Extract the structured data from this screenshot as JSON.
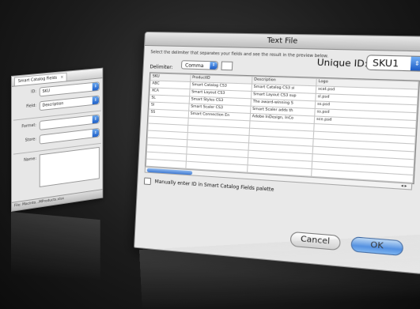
{
  "palette": {
    "tab_label": "Smart Catalog Fields",
    "close_glyph": "×",
    "id_label": "ID:",
    "id_value": "SKU",
    "field_label": "Field:",
    "field_value": "Description",
    "format_label": "Format:",
    "store_label": "Store:",
    "name_label": "Name:",
    "status_text": "File: Macinto...MProducts.xlsx",
    "arrows_glyph": "⇕"
  },
  "dialog": {
    "title": "Text File",
    "instructions": "Select the delimiter that separates your fields and see the result in the preview below.",
    "unique_id_label": "Unique ID:",
    "unique_id_value": "SKU1",
    "delimiter_label": "Delimiter:",
    "delimiter_value": "Comma",
    "arrows_glyph": "⇕",
    "columns": [
      "SKU",
      "ProductID",
      "Description",
      "Logo"
    ],
    "rows": [
      [
        "ABC",
        "Smart Catalog CS3",
        "Smart Catalog CS3 si",
        "scat.psd"
      ],
      [
        "XCA",
        "Smart Layout CS3",
        "Smart Layout CS3 sup",
        "sl.psd"
      ],
      [
        "SL",
        "Smart Styles CS3",
        "The award-winning S",
        "ss.psd"
      ],
      [
        "SI",
        "Smart Scaler CS3",
        "Smart Scaler adds th",
        "ss.psd"
      ],
      [
        "SS",
        "Smart Connection En",
        "Adobe InDesign, InCo",
        "sce.psd"
      ],
      [
        "",
        "",
        "",
        ""
      ],
      [
        "",
        "",
        "",
        ""
      ],
      [
        "",
        "",
        "",
        ""
      ],
      [
        "",
        "",
        "",
        ""
      ],
      [
        "",
        "",
        "",
        ""
      ],
      [
        "",
        "",
        "",
        ""
      ],
      [
        "",
        "",
        "",
        ""
      ],
      [
        "",
        "",
        "",
        ""
      ]
    ],
    "scroll_arrows": "◂ ▸",
    "checkbox_label": "Manually enter ID in Smart Catalog Fields palette",
    "cancel_label": "Cancel",
    "ok_label": "OK"
  }
}
